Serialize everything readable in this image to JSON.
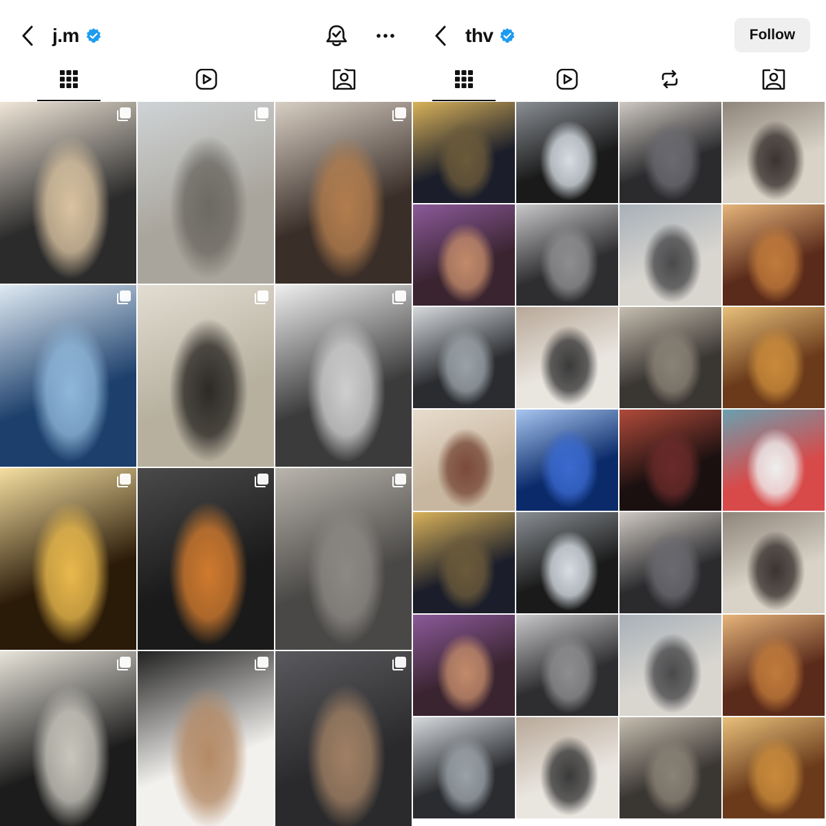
{
  "left": {
    "username": "j.m",
    "tabs": [
      {
        "name": "tab-posts",
        "icon": "grid-icon",
        "active": true
      },
      {
        "name": "tab-reels",
        "icon": "reels-icon",
        "active": false
      },
      {
        "name": "tab-tagged",
        "icon": "tagged-icon",
        "active": false
      }
    ],
    "posts": [
      {
        "desc": "dior-fan-rings",
        "colors": [
          "#2b2b2b",
          "#d9c2a0",
          "#f0e6d8"
        ],
        "multi": true
      },
      {
        "desc": "paris-balcony",
        "colors": [
          "#a9a59c",
          "#6d6a63",
          "#cfd3d6"
        ],
        "multi": true
      },
      {
        "desc": "dog-hallway",
        "colors": [
          "#3a2e28",
          "#b27d4e",
          "#d8cfc4"
        ],
        "multi": true
      },
      {
        "desc": "stage-denim",
        "colors": [
          "#1c3f6b",
          "#8fb7d9",
          "#dfeaf3"
        ],
        "multi": true
      },
      {
        "desc": "mirror-chair",
        "colors": [
          "#b7b09f",
          "#2d2a26",
          "#e2ddd2"
        ],
        "multi": true
      },
      {
        "desc": "white-wall-silhouette",
        "colors": [
          "#3b3b3b",
          "#cfcfcf",
          "#efefef"
        ],
        "multi": true
      },
      {
        "desc": "golden-mic",
        "colors": [
          "#2a1a08",
          "#e9b94c",
          "#f5dfa0"
        ],
        "multi": true
      },
      {
        "desc": "sunset-dark",
        "colors": [
          "#1a1a1a",
          "#d07a2e",
          "#4a4a4a"
        ],
        "multi": true
      },
      {
        "desc": "alley-crouch",
        "colors": [
          "#4a4846",
          "#8c8985",
          "#b9b5ad"
        ],
        "multi": true
      },
      {
        "desc": "boat-deck",
        "colors": [
          "#1c1c1c",
          "#c9c7bd",
          "#e8e4da"
        ],
        "multi": true
      },
      {
        "desc": "camera-studio",
        "colors": [
          "#f3f1ee",
          "#b48a66",
          "#222222"
        ],
        "multi": true
      },
      {
        "desc": "car-selfie",
        "colors": [
          "#2a2a2c",
          "#a08064",
          "#5a5a5e"
        ],
        "multi": true
      }
    ]
  },
  "right": {
    "username": "thv",
    "follow_label": "Follow",
    "tabs": [
      {
        "name": "tab-posts",
        "icon": "grid-icon",
        "active": true
      },
      {
        "name": "tab-reels",
        "icon": "reels-icon",
        "active": false
      },
      {
        "name": "tab-reposts",
        "icon": "repost-icon",
        "active": false
      },
      {
        "name": "tab-tagged",
        "icon": "tagged-icon",
        "active": false
      }
    ],
    "posts": [
      {
        "desc": "night-street",
        "colors": [
          "#1b1e2a",
          "#6b5a3a",
          "#d9b25a"
        ]
      },
      {
        "desc": "masked-selfie",
        "colors": [
          "#1a1a1a",
          "#d6dde3",
          "#8a8f94"
        ]
      },
      {
        "desc": "car-friends",
        "colors": [
          "#2b2b2e",
          "#6a6a70",
          "#cfc9c2"
        ]
      },
      {
        "desc": "plane-phone",
        "colors": [
          "#d9d2c6",
          "#3a3330",
          "#8e857b"
        ]
      },
      {
        "desc": "photobooth-strip",
        "colors": [
          "#3a2430",
          "#c28a6a",
          "#8b5a9a"
        ]
      },
      {
        "desc": "gym-mirror",
        "colors": [
          "#2e2e30",
          "#8e8e90",
          "#c8c8ca"
        ]
      },
      {
        "desc": "two-faces",
        "colors": [
          "#d9d6d0",
          "#4a4a4c",
          "#a8b0b8"
        ]
      },
      {
        "desc": "restaurant-warm",
        "colors": [
          "#5a2a1a",
          "#c07a3a",
          "#e6b47a"
        ]
      },
      {
        "desc": "parking-suits",
        "colors": [
          "#2a2c30",
          "#9aa2a8",
          "#d6dadd"
        ]
      },
      {
        "desc": "id-photo-sheet",
        "colors": [
          "#e9e5df",
          "#3a3a3a",
          "#b8a898"
        ]
      },
      {
        "desc": "backstage-cart",
        "colors": [
          "#3a3632",
          "#8a8276",
          "#c6beb0"
        ]
      },
      {
        "desc": "group-photo-frame",
        "colors": [
          "#6a3a1a",
          "#c98a3a",
          "#e8c07a"
        ]
      },
      {
        "desc": "fisheye-meal",
        "colors": [
          "#c8b7a0",
          "#7a4a3a",
          "#e8dccd"
        ]
      },
      {
        "desc": "blue-stage",
        "colors": [
          "#0a2a6a",
          "#3a6ad0",
          "#a8c6f0"
        ]
      },
      {
        "desc": "night-window",
        "colors": [
          "#1a1010",
          "#6a2a2a",
          "#b04a3a"
        ]
      },
      {
        "desc": "red-cap-mask",
        "colors": [
          "#d84a4a",
          "#efefef",
          "#6aa0b0"
        ]
      },
      {
        "desc": "night-street",
        "colors": [
          "#1b1e2a",
          "#6b5a3a",
          "#d9b25a"
        ]
      },
      {
        "desc": "masked-selfie",
        "colors": [
          "#1a1a1a",
          "#d6dde3",
          "#8a8f94"
        ]
      },
      {
        "desc": "car-friends",
        "colors": [
          "#2b2b2e",
          "#6a6a70",
          "#cfc9c2"
        ]
      },
      {
        "desc": "plane-phone",
        "colors": [
          "#d9d2c6",
          "#3a3330",
          "#8e857b"
        ]
      },
      {
        "desc": "photobooth-strip",
        "colors": [
          "#3a2430",
          "#c28a6a",
          "#8b5a9a"
        ]
      },
      {
        "desc": "gym-mirror",
        "colors": [
          "#2e2e30",
          "#8e8e90",
          "#c8c8ca"
        ]
      },
      {
        "desc": "two-faces",
        "colors": [
          "#d9d6d0",
          "#4a4a4c",
          "#a8b0b8"
        ]
      },
      {
        "desc": "restaurant-warm",
        "colors": [
          "#5a2a1a",
          "#c07a3a",
          "#e6b47a"
        ]
      },
      {
        "desc": "parking-suits",
        "colors": [
          "#2a2c30",
          "#9aa2a8",
          "#d6dadd"
        ]
      },
      {
        "desc": "id-photo-sheet",
        "colors": [
          "#e9e5df",
          "#3a3a3a",
          "#b8a898"
        ]
      },
      {
        "desc": "backstage-cart",
        "colors": [
          "#3a3632",
          "#8a8276",
          "#c6beb0"
        ]
      },
      {
        "desc": "group-photo-frame",
        "colors": [
          "#6a3a1a",
          "#c98a3a",
          "#e8c07a"
        ]
      }
    ]
  },
  "colors": {
    "verified": "#1d9bf0",
    "text": "#111111",
    "follow_bg": "#efefef"
  }
}
